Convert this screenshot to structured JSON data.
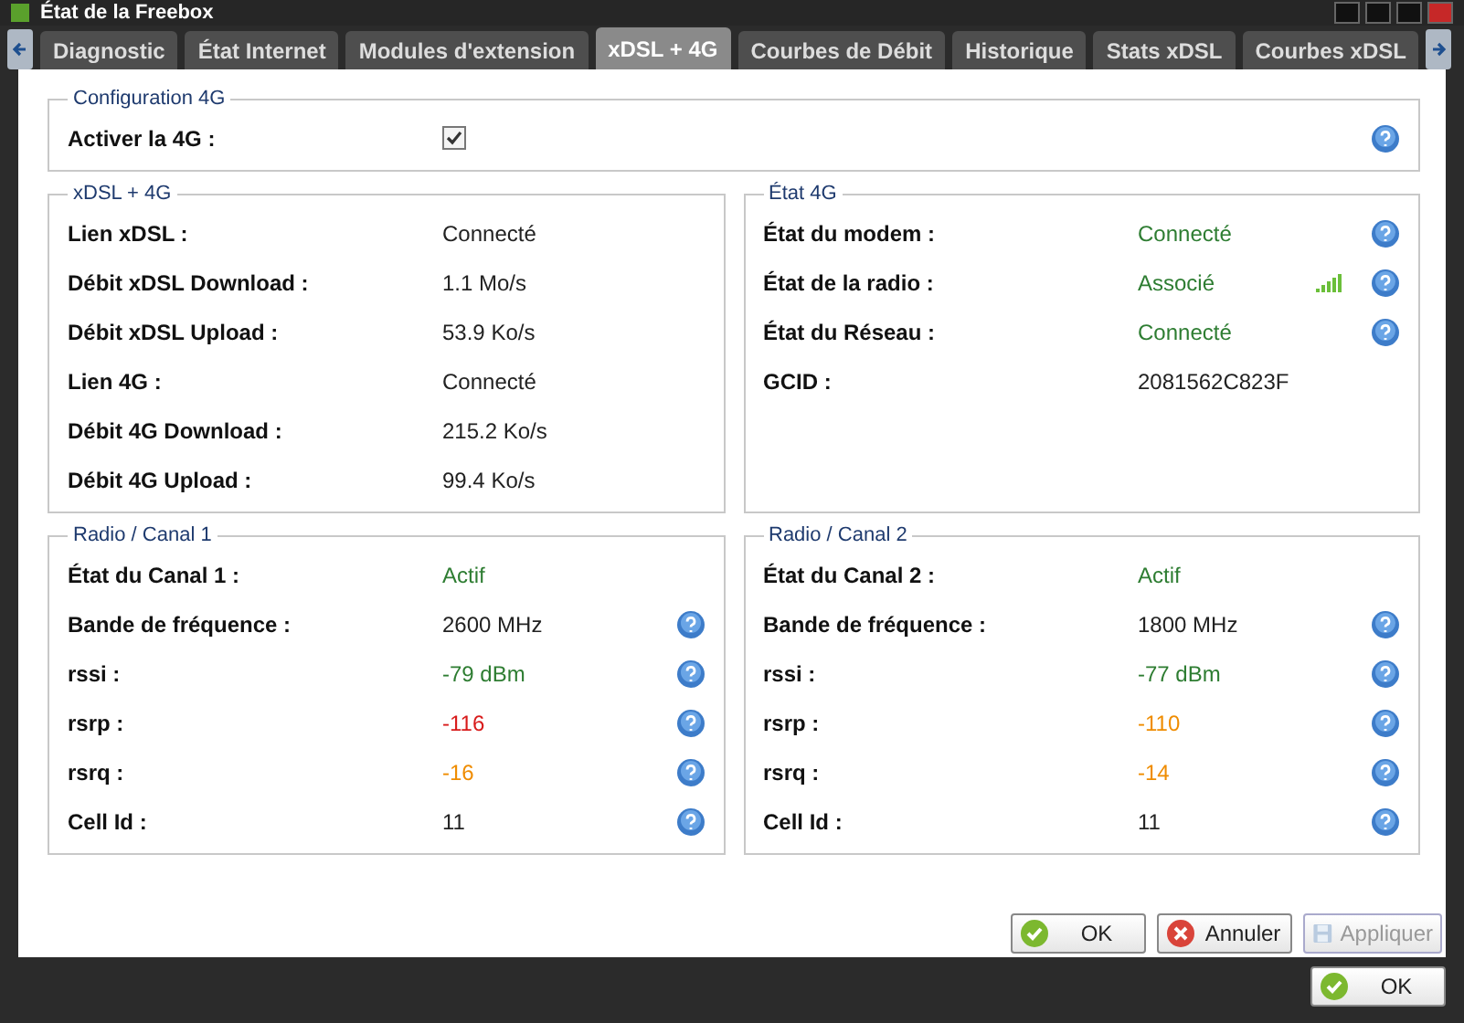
{
  "window": {
    "title": "État de la Freebox"
  },
  "tabs": [
    {
      "label": "Diagnostic",
      "selected": false
    },
    {
      "label": "État Internet",
      "selected": false
    },
    {
      "label": "Modules d'extension",
      "selected": false
    },
    {
      "label": "xDSL + 4G",
      "selected": true
    },
    {
      "label": "Courbes de Débit",
      "selected": false
    },
    {
      "label": "Historique",
      "selected": false
    },
    {
      "label": "Stats xDSL",
      "selected": false
    },
    {
      "label": "Courbes xDSL",
      "selected": false
    }
  ],
  "config": {
    "legend": "Configuration 4G",
    "label": "Activer la 4G :",
    "checked": true
  },
  "sections": [
    {
      "legend": "xDSL + 4G",
      "rows": [
        {
          "label": "Lien xDSL :",
          "value": "Connecté",
          "color": "#222222",
          "help": false,
          "signal": false
        },
        {
          "label": "Débit xDSL Download :",
          "value": "1.1 Mo/s",
          "color": "#222222",
          "help": false,
          "signal": false
        },
        {
          "label": "Débit xDSL Upload :",
          "value": "53.9 Ko/s",
          "color": "#222222",
          "help": false,
          "signal": false
        },
        {
          "label": "Lien 4G :",
          "value": "Connecté",
          "color": "#222222",
          "help": false,
          "signal": false
        },
        {
          "label": "Débit 4G Download :",
          "value": "215.2 Ko/s",
          "color": "#222222",
          "help": false,
          "signal": false
        },
        {
          "label": "Débit 4G Upload :",
          "value": "99.4 Ko/s",
          "color": "#222222",
          "help": false,
          "signal": false
        }
      ]
    },
    {
      "legend": "État 4G",
      "rows": [
        {
          "label": "État du modem :",
          "value": "Connecté",
          "color": "#2e7d32",
          "help": true,
          "signal": false
        },
        {
          "label": "État de la radio :",
          "value": "Associé",
          "color": "#2e7d32",
          "help": true,
          "signal": true
        },
        {
          "label": "État du Réseau :",
          "value": "Connecté",
          "color": "#2e7d32",
          "help": true,
          "signal": false
        },
        {
          "label": "GCID :",
          "value": "2081562C823F",
          "color": "#222222",
          "help": false,
          "signal": false
        }
      ]
    },
    {
      "legend": "Radio / Canal 1",
      "rows": [
        {
          "label": "État du Canal 1 :",
          "value": "Actif",
          "color": "#2e7d32",
          "help": false,
          "signal": false
        },
        {
          "label": "Bande de fréquence :",
          "value": "2600 MHz",
          "color": "#222222",
          "help": true,
          "signal": false
        },
        {
          "label": "rssi :",
          "value": "-79 dBm",
          "color": "#2e7d32",
          "help": true,
          "signal": false
        },
        {
          "label": "rsrp :",
          "value": "-116",
          "color": "#d81b1b",
          "help": true,
          "signal": false
        },
        {
          "label": "rsrq :",
          "value": "-16",
          "color": "#ef8c00",
          "help": true,
          "signal": false
        },
        {
          "label": "Cell Id :",
          "value": "11",
          "color": "#222222",
          "help": true,
          "signal": false
        }
      ]
    },
    {
      "legend": "Radio / Canal 2",
      "rows": [
        {
          "label": "État du Canal 2 :",
          "value": "Actif",
          "color": "#2e7d32",
          "help": false,
          "signal": false
        },
        {
          "label": "Bande de fréquence :",
          "value": "1800 MHz",
          "color": "#222222",
          "help": true,
          "signal": false
        },
        {
          "label": "rssi :",
          "value": "-77 dBm",
          "color": "#2e7d32",
          "help": true,
          "signal": false
        },
        {
          "label": "rsrp :",
          "value": "-110",
          "color": "#ef8c00",
          "help": true,
          "signal": false
        },
        {
          "label": "rsrq :",
          "value": "-14",
          "color": "#ef8c00",
          "help": true,
          "signal": false
        },
        {
          "label": "Cell Id :",
          "value": "11",
          "color": "#222222",
          "help": true,
          "signal": false
        }
      ]
    }
  ],
  "buttons": [
    {
      "kind": "ok",
      "label": "OK",
      "disabled": false
    },
    {
      "kind": "cancel",
      "label": "Annuler",
      "disabled": false
    },
    {
      "kind": "save",
      "label": "Appliquer",
      "disabled": true
    }
  ],
  "footer_button": {
    "kind": "ok",
    "label": "OK",
    "disabled": false
  }
}
